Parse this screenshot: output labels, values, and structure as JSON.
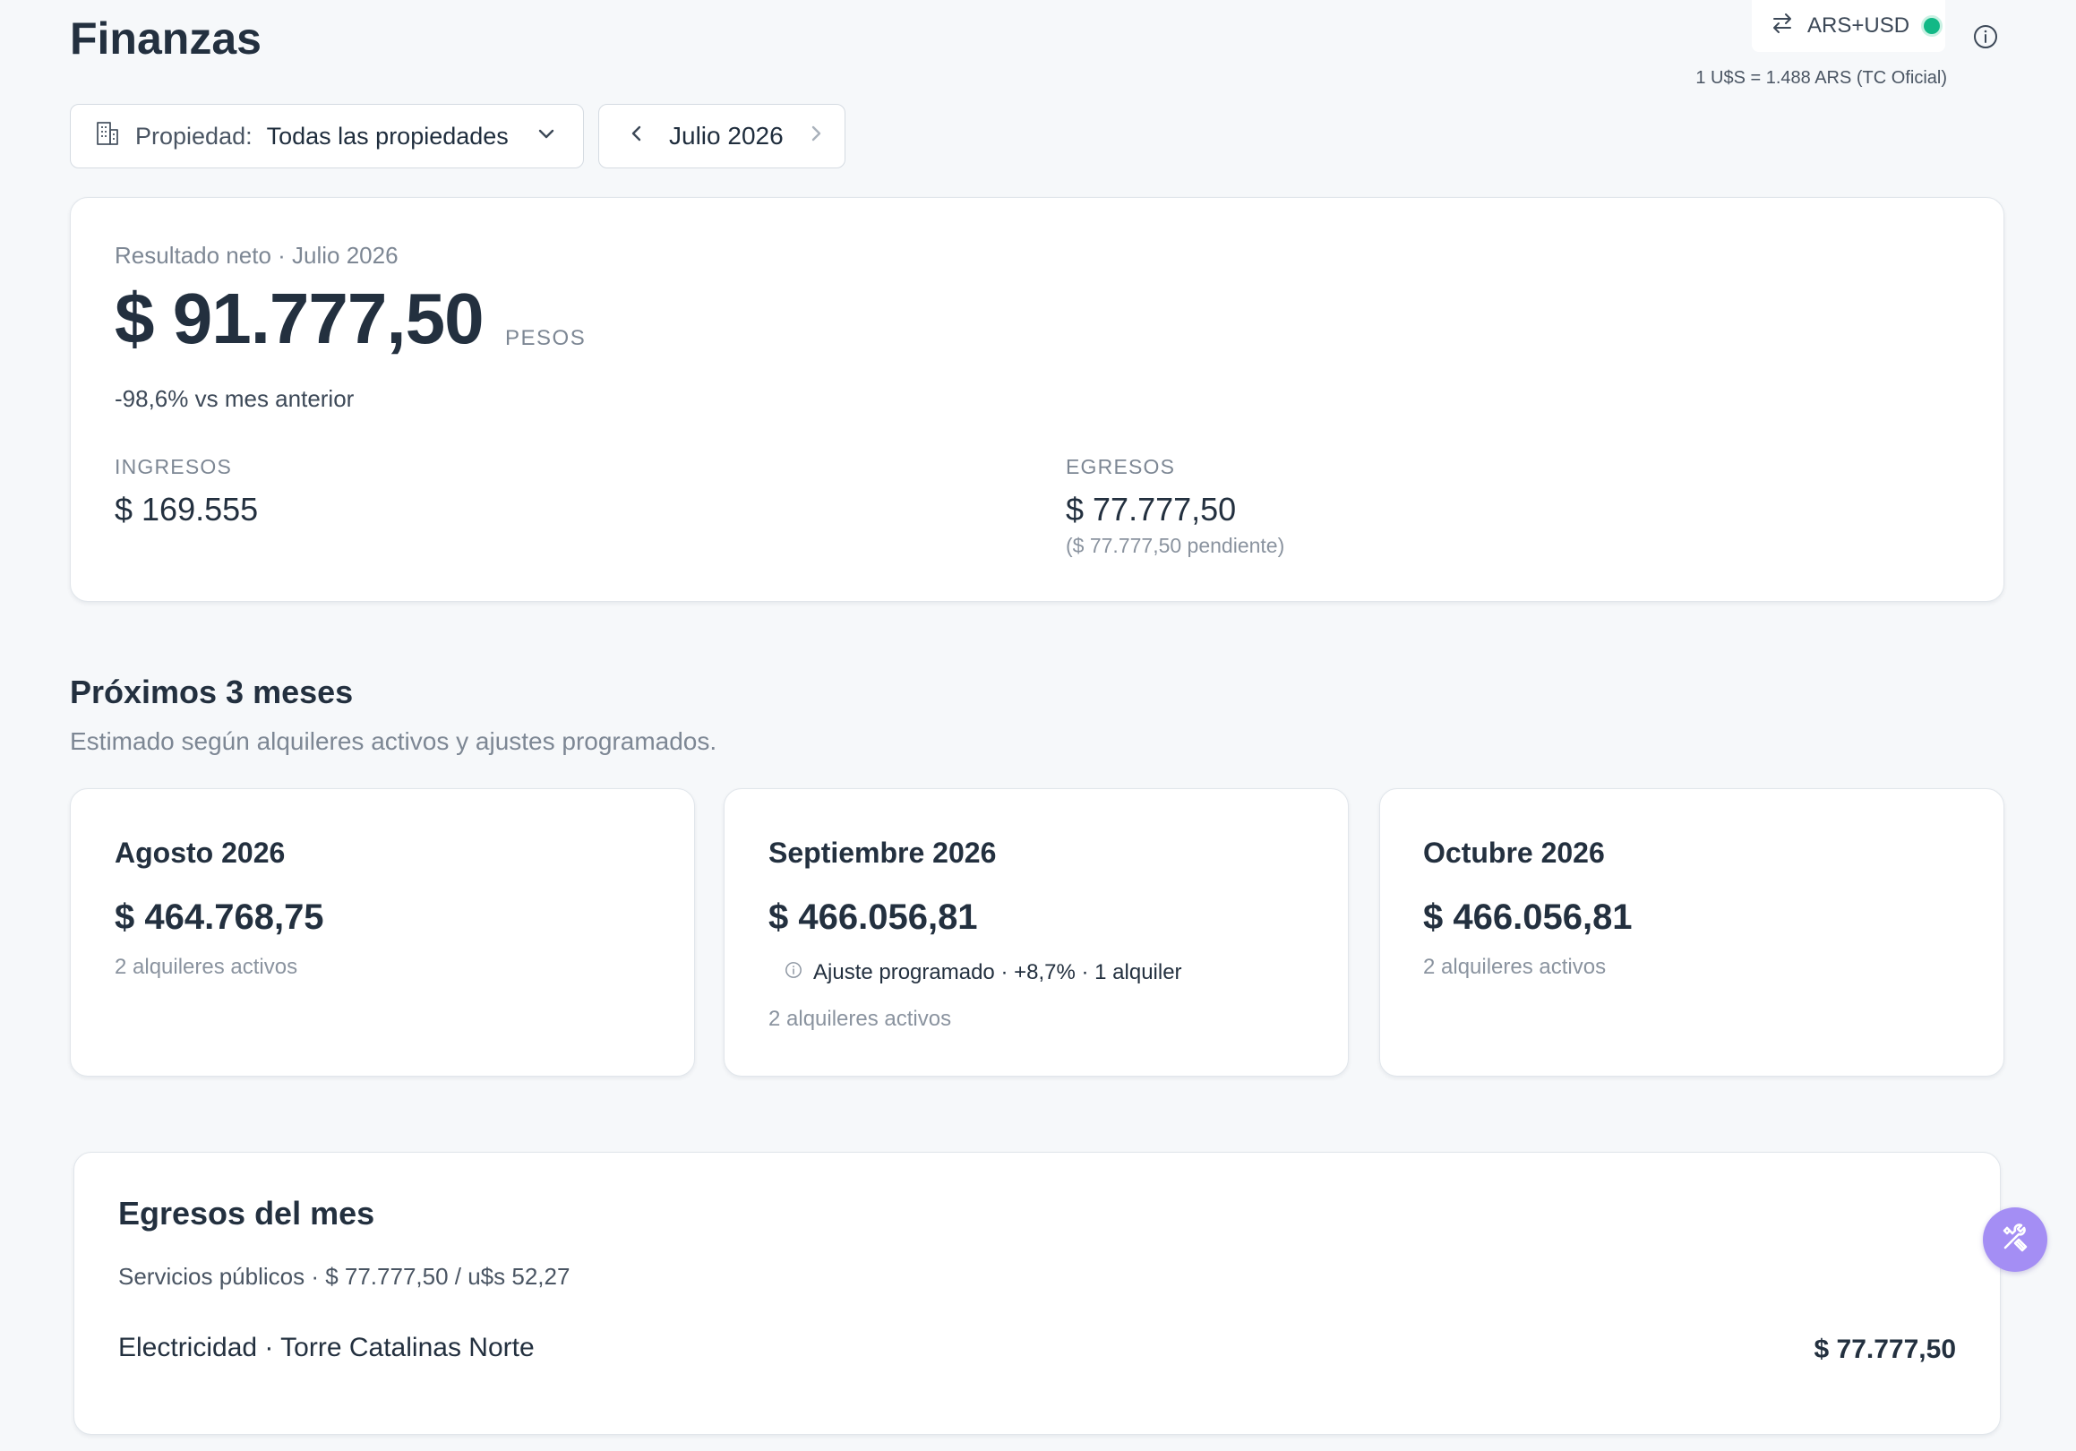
{
  "header": {
    "title": "Finanzas",
    "currency_mode": "ARS+USD",
    "fx_rate": "1 U$S = 1.488 ARS (TC Oficial)"
  },
  "filters": {
    "property_label": "Propiedad:",
    "property_value": "Todas las propiedades",
    "month_value": "Julio 2026"
  },
  "net_result": {
    "label": "Resultado neto · Julio 2026",
    "amount": "$ 91.777,50",
    "unit": "PESOS",
    "comparison": "-98,6% vs mes anterior",
    "income_label": "INGRESOS",
    "income_value": "$ 169.555",
    "expense_label": "EGRESOS",
    "expense_value": "$ 77.777,50",
    "expense_pending": "($ 77.777,50 pendiente)"
  },
  "forecast": {
    "title": "Próximos 3 meses",
    "subtitle": "Estimado según alquileres activos y ajustes programados.",
    "months": [
      {
        "month": "Agosto 2026",
        "amount": "$ 464.768,75",
        "note": "2 alquileres activos"
      },
      {
        "month": "Septiembre 2026",
        "amount": "$ 466.056,81",
        "adjustment": "Ajuste programado · +8,7% · 1 alquiler",
        "note": "2 alquileres activos"
      },
      {
        "month": "Octubre 2026",
        "amount": "$ 466.056,81",
        "note": "2 alquileres activos"
      }
    ]
  },
  "expenses": {
    "title": "Egresos del mes",
    "category": "Servicios públicos · $ 77.777,50 / u$s 52,27",
    "items": [
      {
        "label": "Electricidad · Torre Catalinas Norte",
        "amount": "$ 77.777,50"
      }
    ]
  },
  "colors": {
    "accent_fab": "#a48ef4",
    "status_dot": "#12b886",
    "text_primary": "#23303f",
    "text_muted": "#7d8794"
  },
  "icons": [
    "swap-arrows-icon",
    "status-dot-icon",
    "info-icon",
    "building-icon",
    "chevron-down-icon",
    "chevron-left-icon",
    "chevron-right-icon",
    "tools-icon"
  ]
}
